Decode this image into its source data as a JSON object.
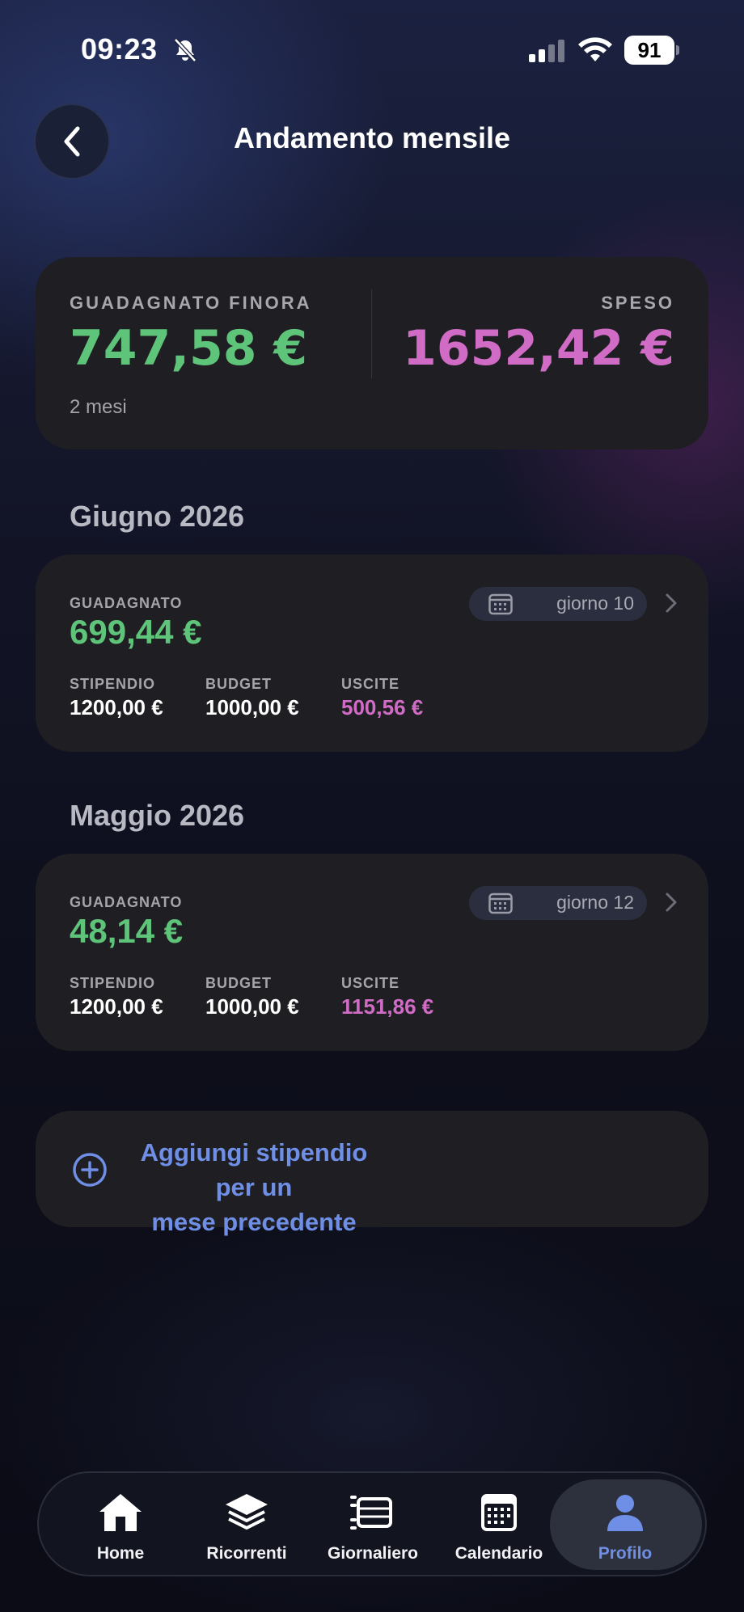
{
  "status_bar": {
    "time": "09:23",
    "battery": "91"
  },
  "header": {
    "title": "Andamento mensile"
  },
  "summary": {
    "earned_label": "GUADAGNATO FINORA",
    "earned_value": "747,58 €",
    "spent_label": "SPESO",
    "spent_value": "1652,42 €",
    "period": "2 mesi"
  },
  "months": [
    {
      "title": "Giugno 2026",
      "earned_label": "GUADAGNATO",
      "earned_value": "699,44 €",
      "day_chip": "giorno 10",
      "columns": [
        {
          "label": "STIPENDIO",
          "value": "1200,00 €"
        },
        {
          "label": "BUDGET",
          "value": "1000,00 €"
        },
        {
          "label": "USCITE",
          "value": "500,56 €"
        }
      ]
    },
    {
      "title": "Maggio 2026",
      "earned_label": "GUADAGNATO",
      "earned_value": "48,14 €",
      "day_chip": "giorno 12",
      "columns": [
        {
          "label": "STIPENDIO",
          "value": "1200,00 €"
        },
        {
          "label": "BUDGET",
          "value": "1000,00 €"
        },
        {
          "label": "USCITE",
          "value": "1151,86 €"
        }
      ]
    }
  ],
  "add_salary": {
    "line1": "Aggiungi stipendio per un",
    "line2": "mese precedente"
  },
  "tab_bar": {
    "active": "Profilo",
    "tabs": [
      {
        "label": "Home",
        "icon": "house-icon"
      },
      {
        "label": "Ricorrenti",
        "icon": "layers-icon"
      },
      {
        "label": "Giornaliero",
        "icon": "list-icon"
      },
      {
        "label": "Calendario",
        "icon": "calendar-icon"
      },
      {
        "label": "Profilo",
        "icon": "person-icon"
      }
    ]
  },
  "colors": {
    "earned_green": "#5ec47a",
    "spent_pink": "#d16cc6",
    "accent_blue": "#6f8fe6",
    "card_bg": "#1f1f23"
  }
}
